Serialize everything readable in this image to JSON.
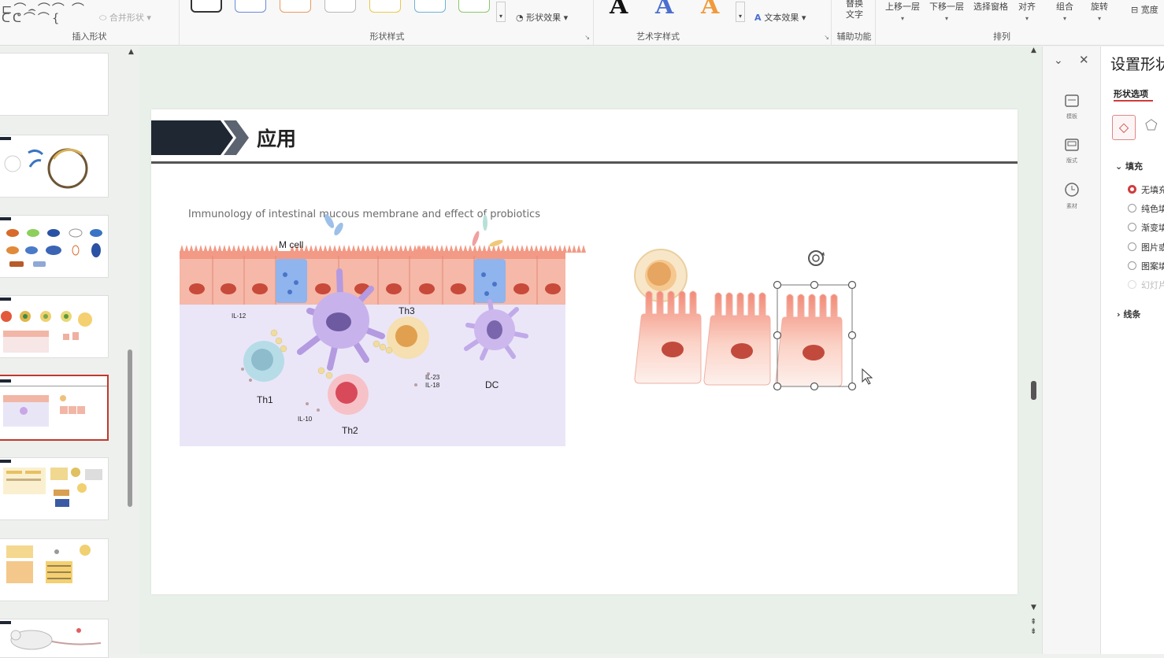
{
  "ribbon": {
    "groups": {
      "insert_shape": {
        "label": "插入形状",
        "merge_shape": "合并形状"
      },
      "shape_styles": {
        "label": "形状样式",
        "shape_effect": "形状效果"
      },
      "wordart_styles": {
        "label": "艺术字样式",
        "text_effect": "文本效果",
        "letters": [
          "A",
          "A",
          "A"
        ]
      },
      "accessibility": {
        "label": "辅助功能",
        "alt_text": "替换文字"
      },
      "arrange": {
        "label": "排列",
        "buttons": [
          "上移一层",
          "下移一层",
          "选择窗格",
          "对齐",
          "组合",
          "旋转"
        ]
      }
    },
    "truncated_right": "宽度"
  },
  "slide": {
    "title": "应用",
    "figure_caption": "Immunology of intestinal mucous membrane and effect of probiotics",
    "figure_labels": {
      "m_cell": "M cell",
      "th1": "Th1",
      "th2": "Th2",
      "th3": "Th3",
      "dc": "DC",
      "il12": "IL-12",
      "il10": "IL-10",
      "il23": "IL-23",
      "il18": "IL-18"
    }
  },
  "task_pane": {
    "title": "设置形状格式",
    "tab": "形状选项",
    "fill_header": "填充",
    "fill_options": [
      {
        "label": "无填充",
        "selected": true
      },
      {
        "label": "纯色填充",
        "selected": false
      },
      {
        "label": "渐变填充",
        "selected": false
      },
      {
        "label": "图片或纹理填充",
        "selected": false
      },
      {
        "label": "图案填充",
        "selected": false
      },
      {
        "label": "幻灯片背景填充",
        "selected": false,
        "disabled": true
      }
    ],
    "line_header": "线条",
    "dock": [
      "模板",
      "版式",
      "素材"
    ]
  },
  "colors": {
    "accent": "#d03c3c",
    "title_block": "#1f2733",
    "cell_pink": "#f4a08f"
  }
}
